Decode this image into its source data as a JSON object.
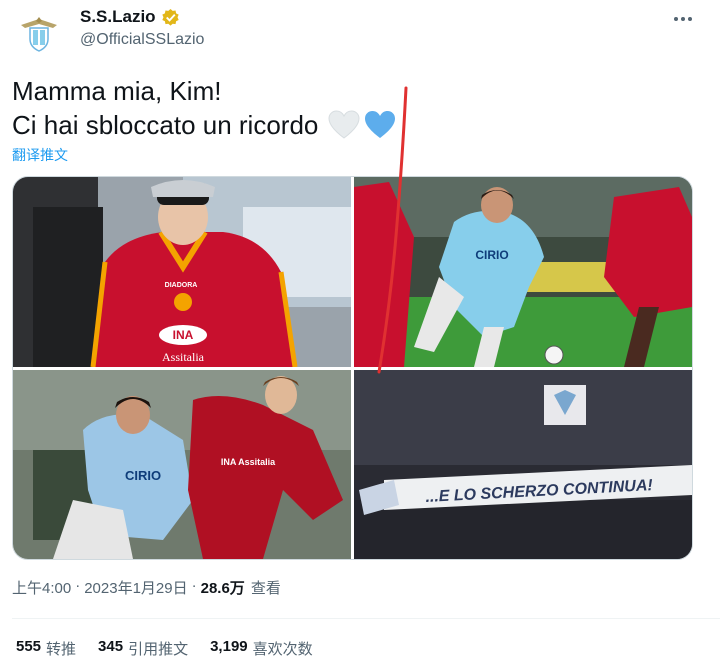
{
  "account": {
    "display_name": "S.S.Lazio",
    "handle": "@OfficialSSLazio",
    "verified": true,
    "avatar_icon": "lazio-eagle-crest-icon"
  },
  "tweet": {
    "line1": "Mamma mia, Kim!",
    "line2": "Ci hai sbloccato un ricordo",
    "emojis": [
      "white-heart-icon",
      "blue-heart-icon"
    ],
    "translate_label": "翻译推文"
  },
  "media": {
    "photos": [
      {
        "name": "photo-kim-roma-jersey",
        "jersey_brand": "DIADORA",
        "jersey_sponsor": "INA",
        "jersey_sponsor2": "Assitalia"
      },
      {
        "name": "photo-lazio-player-dribbling",
        "jersey_sponsor": "CIRIO"
      },
      {
        "name": "photo-lazio-roma-duel",
        "jersey_sponsor": "CIRIO",
        "opponent_sponsor": "INA Assitalia"
      },
      {
        "name": "photo-lazio-fans-banner",
        "banner_text": "...E LO SCHERZO CONTINUA!"
      }
    ]
  },
  "meta": {
    "time": "上午4:00",
    "separator": "·",
    "date": "2023年1月29日",
    "views_count": "28.6万",
    "views_label": "查看"
  },
  "stats": {
    "retweets_count": "555",
    "retweets_label": "转推",
    "quotes_count": "345",
    "quotes_label": "引用推文",
    "likes_count": "3,199",
    "likes_label": "喜欢次数"
  },
  "colors": {
    "accent": "#1d9bf0",
    "text": "#0f1419",
    "muted": "#536471",
    "roma_red": "#c8102e",
    "lazio_blue": "#87ceeb"
  }
}
